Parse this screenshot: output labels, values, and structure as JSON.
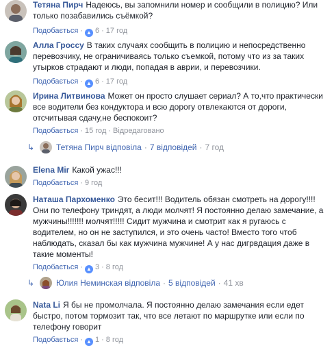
{
  "comments": [
    {
      "author": "Тетяна Пирч",
      "text": "Надеюсь, вы запомнили номер и сообщили в полицию? Или только позабавились съёмкой?",
      "like_label": "Подобається",
      "like_count": "6",
      "time": "17 год"
    },
    {
      "author": "Алла Гроссу",
      "text": "В таких случаях сообщить в полицию и непосредственно перевозчику, не ограничиваясь только съемкой, потому что из за таких утырков страдают и люди, попадая в аврии, и перевозчики.",
      "like_label": "Подобається",
      "like_count": "6",
      "time": "17 год"
    },
    {
      "author": "Ирина Литвинова",
      "text": "Может он просто слушает сериал? А то,что практически все водители без кондуктора и всю дорогу отвлекаются от дороги, отсчитывая сдачу,не беспокоит?",
      "like_label": "Подобається",
      "time": "15 год",
      "edited": "Відредаговано",
      "replies": {
        "name": "Тетяна Пирч",
        "replied": "відповіла",
        "count_label": "7 відповідей",
        "time": "7 год"
      }
    },
    {
      "author": "Elena Mir",
      "text": "Какой ужас!!!",
      "like_label": "Подобається",
      "time": "9 год"
    },
    {
      "author": "Наташа Пархоменко",
      "text": "Это бесит!!! Водитель обязан смотреть на дорогу!!!! Они по телефону триндят, а люди молчят! Я постоянно делаю замечание, а мужчины!!!!!!! молчят!!!!! Сидит мужчина и смотрит как я ругаюсь с водителем, но он не заступился, и это очень часто! Вместо того чтоб наблюдать, сказал бы как мужчина мужчине! А у нас дигрвдация даже в такие моменты!",
      "like_label": "Подобається",
      "like_count": "3",
      "time": "8 год",
      "replies": {
        "name": "Юлия Неминская",
        "replied": "відповіла",
        "count_label": "5 відповідей",
        "time": "41 хв"
      }
    },
    {
      "author": "Nata Li",
      "text": "Я бы не промолчала. Я постоянно делаю замечания если едет быстро, потом тормозит так, что все летают по маршрутке или если по телефону говорит",
      "like_label": "Подобається",
      "like_count": "1",
      "time": "8 год"
    }
  ],
  "icons": {
    "like": "thumbs-up-icon",
    "reply_arrow": "reply-arrow-icon"
  },
  "colors": {
    "link": "#365899",
    "action": "#4267b2",
    "meta": "#90949c",
    "text": "#1d2129"
  }
}
